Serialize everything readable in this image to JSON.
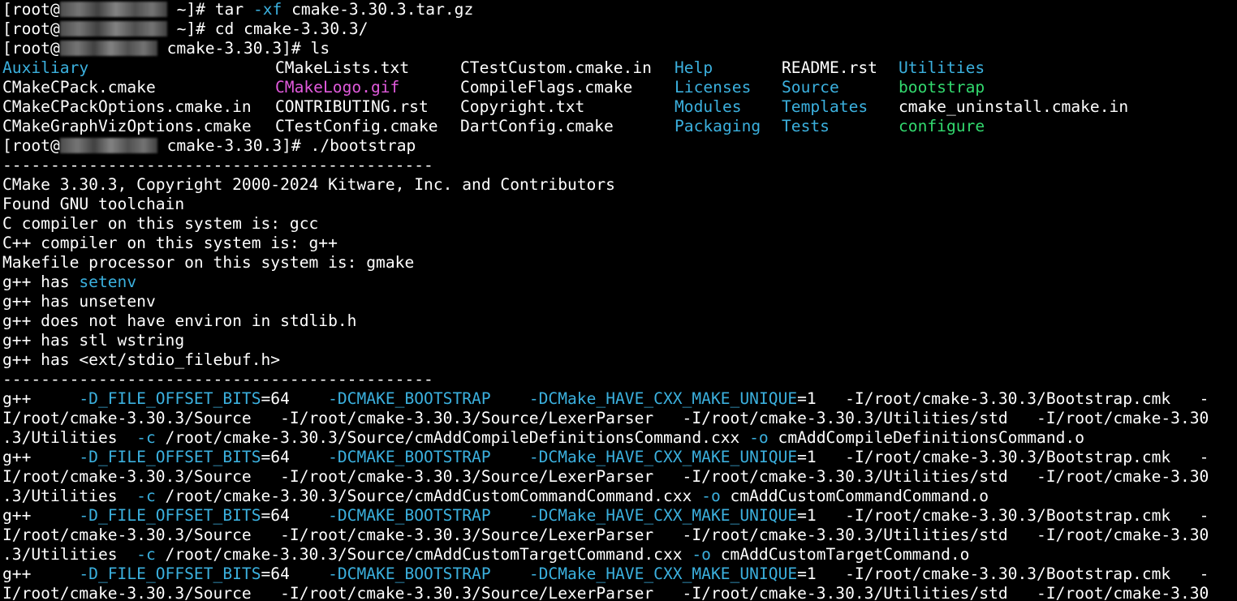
{
  "prompts": [
    {
      "user": "[root@",
      "dir": " ~]# ",
      "cmd": "tar ",
      "flag": "-xf",
      "arg": " cmake-3.30.3.tar.gz"
    },
    {
      "user": "[root@",
      "dir": " ~]# ",
      "cmd": "cd cmake-3.30.3/"
    },
    {
      "user": "[root@",
      "dir": " cmake-3.30.3]# ",
      "cmd": "ls"
    },
    {
      "user": "[root@",
      "dir": " cmake-3.30.3]# ",
      "cmd": "./bootstrap"
    }
  ],
  "ls_rows": [
    [
      "Auxiliary",
      "CMakeLists.txt",
      "CTestCustom.cmake.in",
      "Help",
      "README.rst",
      "Utilities"
    ],
    [
      "CMakeCPack.cmake",
      "CMakeLogo.gif",
      "CompileFlags.cmake",
      "Licenses",
      "Source",
      "bootstrap"
    ],
    [
      "CMakeCPackOptions.cmake.in",
      "CONTRIBUTING.rst",
      "Copyright.txt",
      "Modules",
      "Templates",
      "cmake_uninstall.cmake.in"
    ],
    [
      "CMakeGraphVizOptions.cmake",
      "CTestConfig.cmake",
      "DartConfig.cmake",
      "Packaging",
      "Tests",
      "configure"
    ]
  ],
  "separator": "---------------------------------------------",
  "bootstrap": {
    "copyright": "CMake 3.30.3, Copyright 2000-2024 Kitware, Inc. and Contributors",
    "toolchain": "Found GNU toolchain",
    "c_compiler": "C compiler on this system is: gcc",
    "cxx_compiler": "C++ compiler on this system is: g++",
    "makefile": "Makefile processor on this system is: gmake",
    "has_setenv_prefix": "g++ has ",
    "has_setenv_word": "setenv",
    "has_unsetenv": "g++ has unsetenv",
    "no_environ": "g++ does not have environ in stdlib.h",
    "wstring": "g++ has stl wstring",
    "stdio_filebuf": "g++ has <ext/stdio_filebuf.h>"
  },
  "compile": {
    "cc": "g++",
    "gap1": "     ",
    "d1_flag": "-D_FILE_OFFSET_BITS",
    "d1_val": "=64",
    "gap2": "    ",
    "d2_flag": "-DCMAKE_BOOTSTRAP",
    "gap3": "    ",
    "d3_flag": "-DCMake_HAVE_CXX_MAKE_UNIQUE",
    "d3_val": "=1",
    "inc1_tail": "   -I/root/cmake-3.30.3/Bootstrap.cmk   -",
    "inc2": "I/root/cmake-3.30.3/Source   -I/root/cmake-3.30.3/Source/LexerParser   -I/root/cmake-3.30.3/Utilities/std   -I/root/cmake-3.30",
    "util_prefix": ".3/Utilities  ",
    "c_flag": "-c",
    "o_flag": "-o",
    "units": [
      {
        "src": " /root/cmake-3.30.3/Source/cmAddCompileDefinitionsCommand.cxx ",
        "obj": " cmAddCompileDefinitionsCommand.o"
      },
      {
        "src": " /root/cmake-3.30.3/Source/cmAddCustomCommandCommand.cxx ",
        "obj": " cmAddCustomCommandCommand.o"
      },
      {
        "src": " /root/cmake-3.30.3/Source/cmAddCustomTargetCommand.cxx ",
        "obj": " cmAddCustomTargetCommand.o"
      }
    ]
  },
  "colors": {
    "directory": "#3bb0de",
    "image": "#e15adc",
    "executable": "#32d96e",
    "flag": "#3bb0de",
    "background": "#000000",
    "text": "#ffffff"
  }
}
